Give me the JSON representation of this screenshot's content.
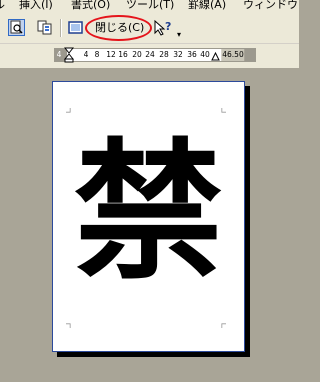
{
  "menubar": {
    "items": [
      {
        "label": "ル"
      },
      {
        "label": "挿入(I)"
      },
      {
        "label": "書式(O)"
      },
      {
        "label": "ツール(T)"
      },
      {
        "label": "罫線(A)"
      },
      {
        "label": "ウィンドウ"
      }
    ]
  },
  "toolbar": {
    "close_label": "閉じる(C)",
    "icons": [
      "magnifier-icon",
      "multi-page-icon",
      "full-screen-icon",
      "help-pointer-icon"
    ]
  },
  "ruler": {
    "left_margin_label": "4",
    "ticks": [
      "4",
      "8",
      "12",
      "16",
      "20",
      "24",
      "28",
      "32",
      "36",
      "40"
    ],
    "right_label": "46.50"
  },
  "document": {
    "text": "禁"
  },
  "colors": {
    "highlight": "#e5141b",
    "page_frame": "#2c4a9c"
  }
}
